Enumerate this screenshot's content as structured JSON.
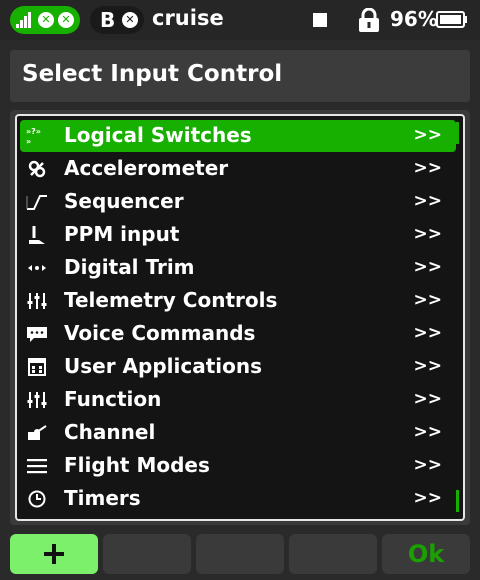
{
  "status_bar": {
    "model_letter": "B",
    "model_name": "cruise",
    "battery_percent": "96%"
  },
  "dialog": {
    "title": "Select Input Control",
    "items": [
      {
        "label": "Logical Switches",
        "arrow": ">>",
        "icon": "logical-switch-icon",
        "selected": true
      },
      {
        "label": "Accelerometer",
        "arrow": ">>",
        "icon": "accelerometer-icon"
      },
      {
        "label": "Sequencer",
        "arrow": ">>",
        "icon": "sequencer-icon"
      },
      {
        "label": "PPM input",
        "arrow": ">>",
        "icon": "ppm-input-icon"
      },
      {
        "label": "Digital Trim",
        "arrow": ">>",
        "icon": "digital-trim-icon"
      },
      {
        "label": "Telemetry Controls",
        "arrow": ">>",
        "icon": "sliders-icon"
      },
      {
        "label": "Voice Commands",
        "arrow": ">>",
        "icon": "speech-bubble-icon"
      },
      {
        "label": "User Applications",
        "arrow": ">>",
        "icon": "calendar-grid-icon"
      },
      {
        "label": "Function",
        "arrow": ">>",
        "icon": "sliders-icon"
      },
      {
        "label": "Channel",
        "arrow": ">>",
        "icon": "servo-icon"
      },
      {
        "label": "Flight Modes",
        "arrow": ">>",
        "icon": "hamburger-icon"
      },
      {
        "label": "Timers",
        "arrow": ">>",
        "icon": "clock-icon"
      }
    ]
  },
  "buttons": {
    "ok_label": "Ok"
  },
  "colors": {
    "accent": "#18b000",
    "accent_light": "#7cf06a"
  }
}
